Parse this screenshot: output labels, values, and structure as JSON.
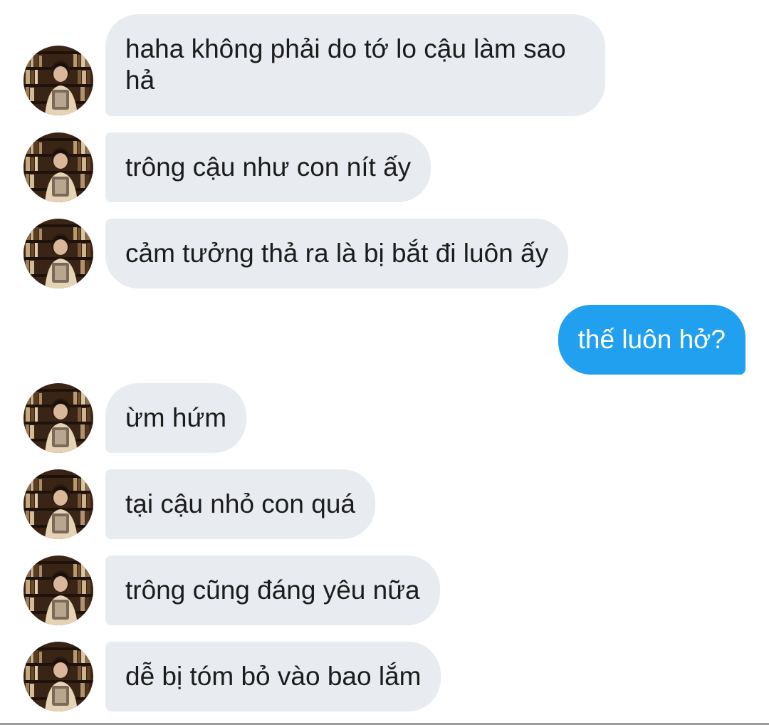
{
  "conversation": {
    "messages": [
      {
        "direction": "incoming",
        "text": "haha không phải do tớ lo cậu làm sao hả"
      },
      {
        "direction": "incoming",
        "text": "trông cậu như con nít ấy"
      },
      {
        "direction": "incoming",
        "text": "cảm tưởng thả ra là bị bắt đi luôn ấy"
      },
      {
        "direction": "outgoing",
        "text": "thế luôn hở?"
      },
      {
        "direction": "incoming",
        "text": "ừm hứm"
      },
      {
        "direction": "incoming",
        "text": "tại cậu nhỏ con quá"
      },
      {
        "direction": "incoming",
        "text": "trông cũng đáng yêu nữa"
      },
      {
        "direction": "incoming",
        "text": "dễ bị tóm bỏ vào bao lắm"
      }
    ]
  },
  "colors": {
    "incoming_bubble": "#e8ebef",
    "outgoing_bubble": "#22a0f0",
    "incoming_text": "#1c1c1c",
    "outgoing_text": "#ffffff"
  },
  "icons": {
    "avatar": "contact-avatar-photo"
  }
}
